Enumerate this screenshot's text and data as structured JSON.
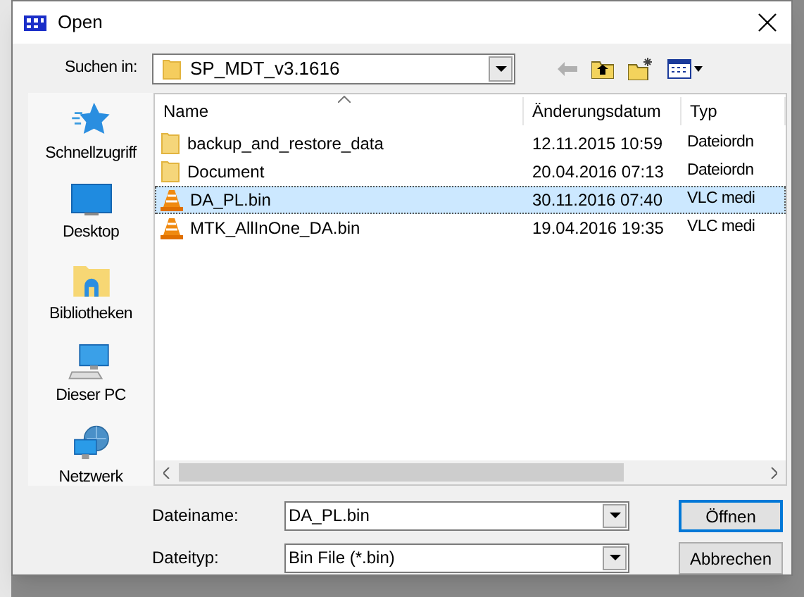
{
  "window": {
    "title": "Open"
  },
  "look_in": {
    "label": "Suchen in:",
    "value": "SP_MDT_v3.1616"
  },
  "sidebar": {
    "items": [
      {
        "label": "Schnellzugriff",
        "kind": "star"
      },
      {
        "label": "Desktop",
        "kind": "desktop"
      },
      {
        "label": "Bibliotheken",
        "kind": "library"
      },
      {
        "label": "Dieser PC",
        "kind": "pc"
      },
      {
        "label": "Netzwerk",
        "kind": "network"
      }
    ]
  },
  "table": {
    "columns": [
      "Name",
      "Änderungsdatum",
      "Typ"
    ],
    "rows": [
      {
        "kind": "folder",
        "name": "backup_and_restore_data",
        "date": "12.11.2015 10:59",
        "type": "Dateiordn",
        "selected": false
      },
      {
        "kind": "folder",
        "name": "Document",
        "date": "20.04.2016 07:13",
        "type": "Dateiordn",
        "selected": false
      },
      {
        "kind": "vlc",
        "name": "DA_PL.bin",
        "date": "30.11.2016 07:40",
        "type": "VLC medi",
        "selected": true
      },
      {
        "kind": "vlc",
        "name": "MTK_AllInOne_DA.bin",
        "date": "19.04.2016 19:35",
        "type": "VLC medi",
        "selected": false
      }
    ]
  },
  "file_name": {
    "label": "Dateiname:",
    "value": "DA_PL.bin"
  },
  "file_type": {
    "label": "Dateityp:",
    "value": "Bin File (*.bin)"
  },
  "buttons": [
    "Öffnen",
    "Abbrechen"
  ]
}
